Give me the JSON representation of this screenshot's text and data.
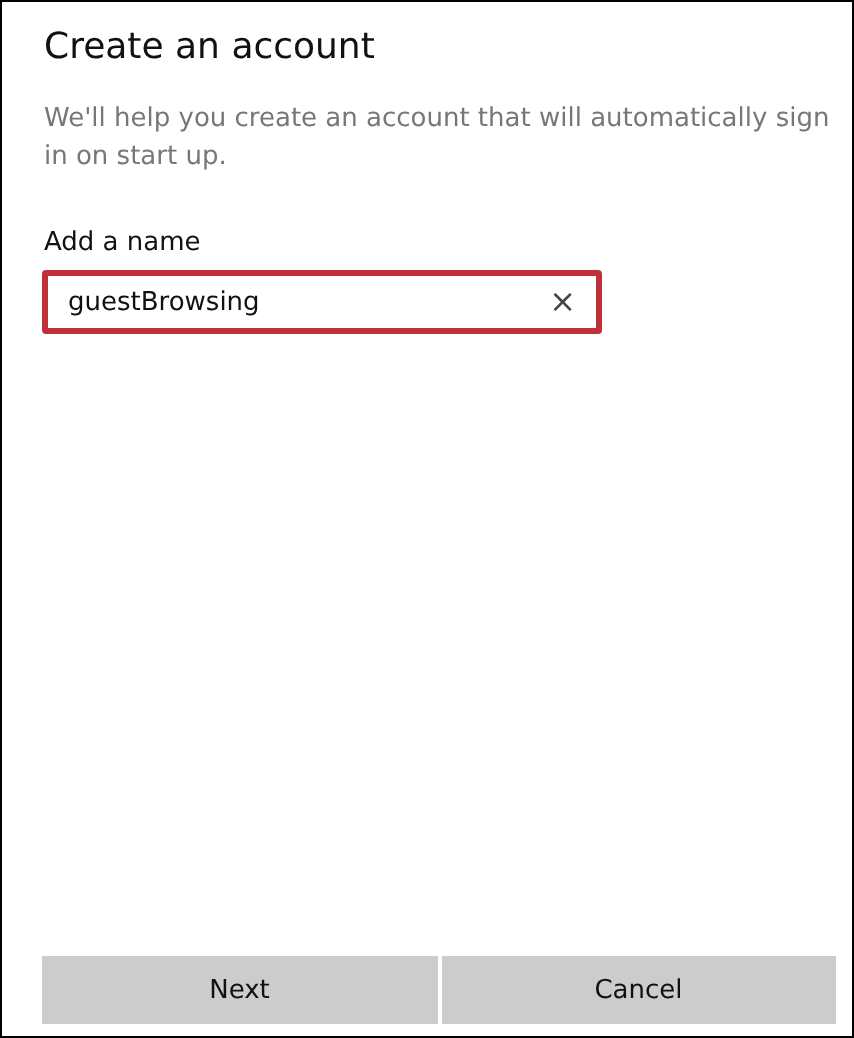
{
  "title": "Create an account",
  "description": "We'll help you create an account that will automatically sign in on start up.",
  "name_field": {
    "label": "Add a name",
    "value": "guestBrowsing",
    "highlighted": true,
    "clear_button": "×"
  },
  "buttons": [
    "Next",
    "Cancel"
  ]
}
